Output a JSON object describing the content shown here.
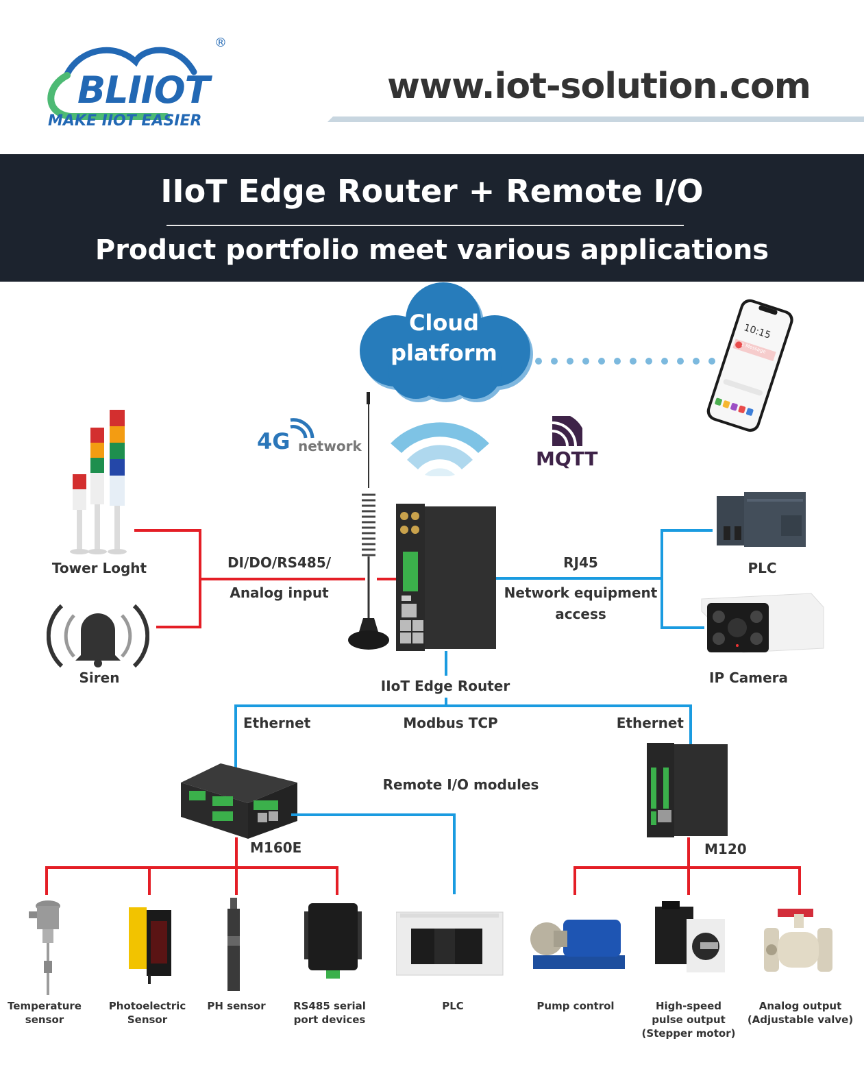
{
  "header": {
    "logo": {
      "brand": "BLIIOT",
      "tagline": "MAKE IIOT EASIER",
      "registered": "®"
    },
    "website": "www.iot-solution.com"
  },
  "banner": {
    "title": "IIoT Edge Router + Remote I/O",
    "subtitle": "Product portfolio meet various applications"
  },
  "cloud": {
    "line1": "Cloud",
    "line2": "platform"
  },
  "phone": {
    "time": "10:15",
    "notification": "1 Message"
  },
  "badges": {
    "network_4g": "4G",
    "network_word": "network",
    "mqtt": "MQTT"
  },
  "left": {
    "tower_light": "Tower Loght",
    "siren": "Siren",
    "interface_line1": "DI/DO/RS485/",
    "interface_line2": "Analog input"
  },
  "right": {
    "interface_line1": "RJ45",
    "interface_line2": "Network equipment",
    "interface_line3": "access",
    "plc": "PLC",
    "ip_camera": "IP Camera"
  },
  "router": {
    "label": "IIoT Edge Router"
  },
  "bus": {
    "ethernet_left": "Ethernet",
    "protocol": "Modbus TCP",
    "ethernet_right": "Ethernet",
    "remote_io": "Remote I/O modules"
  },
  "modules": {
    "m160e": "M160E",
    "m120": "M120"
  },
  "devices": [
    {
      "line1": "Temperature",
      "line2": "sensor",
      "line3": ""
    },
    {
      "line1": "Photoelectric",
      "line2": "Sensor",
      "line3": ""
    },
    {
      "line1": "PH sensor",
      "line2": "",
      "line3": ""
    },
    {
      "line1": "RS485 serial",
      "line2": "port devices",
      "line3": ""
    },
    {
      "line1": "PLC",
      "line2": "",
      "line3": ""
    },
    {
      "line1": "Pump control",
      "line2": "",
      "line3": ""
    },
    {
      "line1": "High-speed",
      "line2": "pulse output",
      "line3": "(Stepper motor)"
    },
    {
      "line1": "Analog output",
      "line2": "(Adjustable valve)",
      "line3": ""
    }
  ],
  "colors": {
    "brand_blue": "#2268b4",
    "brand_green": "#4dba74",
    "banner_bg": "#1c232e",
    "io_wire": "#e41e26",
    "network_wire": "#1a9be0",
    "cloud": "#277cbb",
    "mqtt": "#3e2348"
  }
}
